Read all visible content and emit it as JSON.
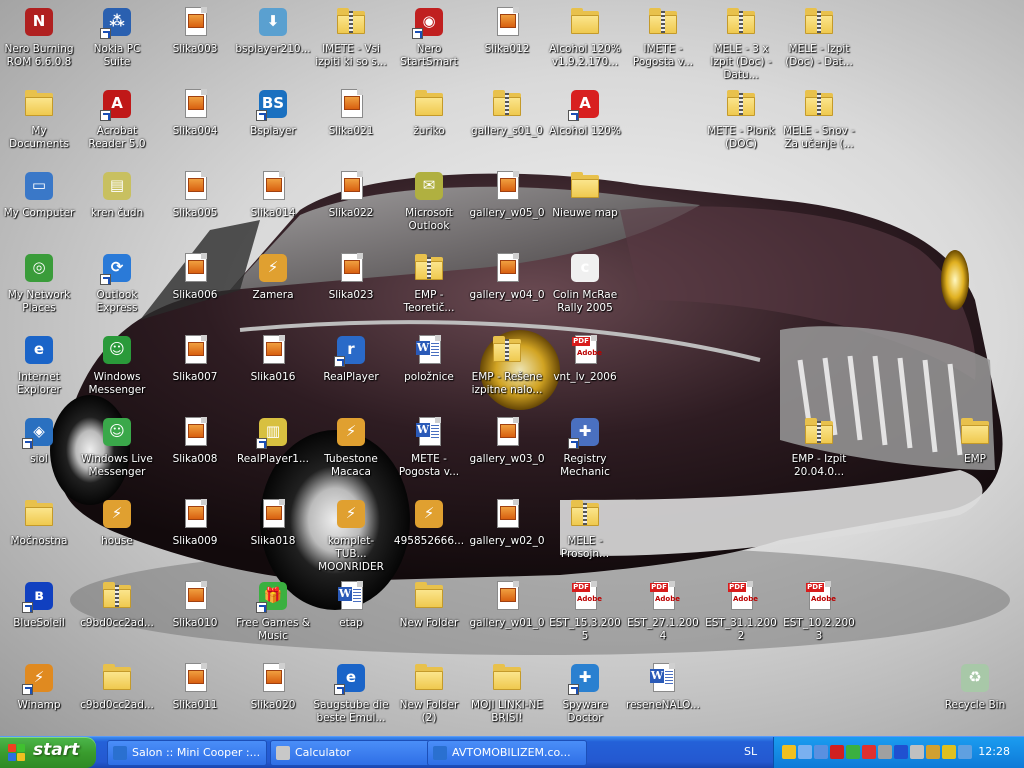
{
  "desktop": {
    "icons": [
      {
        "label": "Nero Burning ROM 6.6.0.8",
        "type": "app",
        "color": "#b02020",
        "sym": "N",
        "shortcut": false
      },
      {
        "label": "My Documents",
        "type": "folder",
        "shortcut": false
      },
      {
        "label": "My Computer",
        "type": "app",
        "color": "#3a78c8",
        "sym": "▭",
        "shortcut": false
      },
      {
        "label": "My Network Places",
        "type": "app",
        "color": "#3a9c3a",
        "sym": "◎",
        "shortcut": false
      },
      {
        "label": "Internet Explorer",
        "type": "app",
        "color": "#1a64c8",
        "sym": "e",
        "shortcut": false
      },
      {
        "label": "siol",
        "type": "app",
        "color": "#2a70c0",
        "sym": "◈",
        "shortcut": true
      },
      {
        "label": "Močnostna",
        "type": "folder",
        "shortcut": false
      },
      {
        "label": "BlueSoleil",
        "type": "app",
        "color": "#1040c0",
        "sym": "ʙ",
        "shortcut": true
      },
      {
        "label": "Winamp",
        "type": "app",
        "color": "#e08a20",
        "sym": "⚡",
        "shortcut": true
      },
      {
        "label": "Nokia PC Suite",
        "type": "app",
        "color": "#2a60b0",
        "sym": "⁂",
        "shortcut": true
      },
      {
        "label": "Acrobat Reader 5.0",
        "type": "app",
        "color": "#c01818",
        "sym": "A",
        "shortcut": true
      },
      {
        "label": "kren čudn",
        "type": "app",
        "color": "#c8c060",
        "sym": "▤",
        "shortcut": false
      },
      {
        "label": "Outlook Express",
        "type": "app",
        "color": "#2a7ad8",
        "sym": "⟳",
        "shortcut": true
      },
      {
        "label": "Windows Messenger",
        "type": "app",
        "color": "#2a9a3a",
        "sym": "☺",
        "shortcut": false
      },
      {
        "label": "Windows Live Messenger",
        "type": "app",
        "color": "#3aa84a",
        "sym": "☺",
        "shortcut": false
      },
      {
        "label": "house",
        "type": "app",
        "color": "#e0a030",
        "sym": "⚡",
        "shortcut": false
      },
      {
        "label": "c9bd0cc2ad...",
        "type": "zip",
        "shortcut": false
      },
      {
        "label": "c9bd0cc2ad...",
        "type": "folder",
        "shortcut": false
      },
      {
        "label": "Slika003",
        "type": "img",
        "shortcut": false
      },
      {
        "label": "Slika004",
        "type": "img",
        "shortcut": false
      },
      {
        "label": "Slika005",
        "type": "img",
        "shortcut": false
      },
      {
        "label": "Slika006",
        "type": "img",
        "shortcut": false
      },
      {
        "label": "Slika007",
        "type": "img",
        "shortcut": false
      },
      {
        "label": "Slika008",
        "type": "img",
        "shortcut": false
      },
      {
        "label": "Slika009",
        "type": "img",
        "shortcut": false
      },
      {
        "label": "Slika010",
        "type": "img",
        "shortcut": false
      },
      {
        "label": "Slika011",
        "type": "img",
        "shortcut": false
      },
      {
        "label": "bsplayer210...",
        "type": "app",
        "color": "#5aa0d0",
        "sym": "⬇",
        "shortcut": false
      },
      {
        "label": "Bsplayer",
        "type": "app",
        "color": "#1a70c0",
        "sym": "BS",
        "shortcut": true
      },
      {
        "label": "Slika014",
        "type": "img",
        "shortcut": false
      },
      {
        "label": "Zamera",
        "type": "app",
        "color": "#e0a030",
        "sym": "⚡",
        "shortcut": false
      },
      {
        "label": "Slika016",
        "type": "img",
        "shortcut": false
      },
      {
        "label": "RealPlayer1...",
        "type": "app",
        "color": "#d8c040",
        "sym": "▥",
        "shortcut": true
      },
      {
        "label": "Slika018",
        "type": "img",
        "shortcut": false
      },
      {
        "label": "Free Games & Music",
        "type": "app",
        "color": "#3ab040",
        "sym": "🎁",
        "shortcut": true
      },
      {
        "label": "Slika020",
        "type": "img",
        "shortcut": false
      },
      {
        "label": "IMETE - Vsi izpiti ki so s...",
        "type": "zip",
        "shortcut": false
      },
      {
        "label": "Slika021",
        "type": "img",
        "shortcut": false
      },
      {
        "label": "Slika022",
        "type": "img",
        "shortcut": false
      },
      {
        "label": "Slika023",
        "type": "img",
        "shortcut": false
      },
      {
        "label": "RealPlayer",
        "type": "app",
        "color": "#2a6ac8",
        "sym": "r",
        "shortcut": true
      },
      {
        "label": "Tubestone Macaca",
        "type": "app",
        "color": "#e0a030",
        "sym": "⚡",
        "shortcut": false
      },
      {
        "label": "komplet-TUB... MOONRIDER",
        "type": "app",
        "color": "#e0a030",
        "sym": "⚡",
        "shortcut": false
      },
      {
        "label": "etap",
        "type": "word",
        "shortcut": false
      },
      {
        "label": "Saugstube die beste Emul...",
        "type": "app",
        "color": "#1a64c8",
        "sym": "e",
        "shortcut": true
      },
      {
        "label": "Nero StartSmart",
        "type": "app",
        "color": "#c02020",
        "sym": "◉",
        "shortcut": true
      },
      {
        "label": "žuriko",
        "type": "folder",
        "shortcut": false
      },
      {
        "label": "Microsoft Outlook",
        "type": "app",
        "color": "#b0b040",
        "sym": "✉",
        "shortcut": false
      },
      {
        "label": "EMP - Teoretič...",
        "type": "zip",
        "shortcut": false
      },
      {
        "label": "položnice",
        "type": "word",
        "shortcut": false
      },
      {
        "label": "METE - Pogosta v...",
        "type": "word",
        "shortcut": false
      },
      {
        "label": "495852666...",
        "type": "app",
        "color": "#e0a030",
        "sym": "⚡",
        "shortcut": false
      },
      {
        "label": "New Folder",
        "type": "folder",
        "shortcut": false
      },
      {
        "label": "New Folder (2)",
        "type": "folder",
        "shortcut": false
      },
      {
        "label": "Slika012",
        "type": "img",
        "shortcut": false
      },
      {
        "label": "gallery_s01_0",
        "type": "zip",
        "shortcut": false
      },
      {
        "label": "gallery_w05_0",
        "type": "img",
        "shortcut": false
      },
      {
        "label": "gallery_w04_0",
        "type": "img",
        "shortcut": false
      },
      {
        "label": "EMP - Rešene izpitne nalo...",
        "type": "zip",
        "shortcut": false
      },
      {
        "label": "gallery_w03_0",
        "type": "img",
        "shortcut": false
      },
      {
        "label": "gallery_w02_0",
        "type": "img",
        "shortcut": false
      },
      {
        "label": "gallery_w01_0",
        "type": "img",
        "shortcut": false
      },
      {
        "label": "MOJI LINKI-NE BRISI!",
        "type": "folder",
        "shortcut": false
      },
      {
        "label": "Alcohol 120% v1.9.2.170...",
        "type": "folder",
        "shortcut": false
      },
      {
        "label": "Alcohol 120%",
        "type": "app",
        "color": "#d82020",
        "sym": "A",
        "shortcut": true
      },
      {
        "label": "Nieuwe map",
        "type": "folder",
        "shortcut": false
      },
      {
        "label": "Colin McRae Rally 2005",
        "type": "app",
        "color": "#f0f0f0",
        "sym": "c",
        "shortcut": false
      },
      {
        "label": "vnt_lv_2006",
        "type": "pdf",
        "shortcut": false
      },
      {
        "label": "Registry Mechanic",
        "type": "app",
        "color": "#4a70c0",
        "sym": "✚",
        "shortcut": true
      },
      {
        "label": "MELE - Prosojn...",
        "type": "zip",
        "shortcut": false
      },
      {
        "label": "EST_15.3.2005",
        "type": "pdf",
        "shortcut": false
      },
      {
        "label": "Spyware Doctor",
        "type": "app",
        "color": "#2a80d0",
        "sym": "✚",
        "shortcut": true
      },
      {
        "label": "IMETE - Pogosta v...",
        "type": "zip",
        "shortcut": false
      },
      {
        "label": "EST_27.1.2004",
        "type": "pdf",
        "shortcut": false
      },
      {
        "label": "reseneNALO...",
        "type": "word",
        "shortcut": false
      },
      {
        "label": "MELE - 3 x Izpit (Doc) - Datu...",
        "type": "zip",
        "shortcut": false
      },
      {
        "label": "METE - Plonk (DOC)",
        "type": "zip",
        "shortcut": false
      },
      {
        "label": "EST_31.1.2002",
        "type": "pdf",
        "shortcut": false
      },
      {
        "label": "MELE - Izpit (Doc) - Dat...",
        "type": "zip",
        "shortcut": false
      },
      {
        "label": "MELE - Snov - Za učenje (...",
        "type": "zip",
        "shortcut": false
      },
      {
        "label": "EMP - Izpit 20.04.0...",
        "type": "zip",
        "shortcut": false
      },
      {
        "label": "EST_10.2.2003",
        "type": "pdf",
        "shortcut": false
      },
      {
        "label": "EMP",
        "type": "folder",
        "shortcut": false
      },
      {
        "label": "Recycle Bin",
        "type": "app",
        "color": "#a8c8a8",
        "sym": "♻",
        "shortcut": false
      }
    ]
  },
  "taskbar": {
    "start_label": "start",
    "tasks": [
      {
        "label": "Salon :: Mini Cooper :...",
        "color": "#2a70d0"
      },
      {
        "label": "Calculator",
        "color": "#c8c8c8"
      },
      {
        "label": "AVTOMOBILIZEM.co...",
        "color": "#2a70d0"
      }
    ],
    "language": "SL",
    "tray_icons": [
      {
        "name": "shield-icon",
        "color": "#f0c020"
      },
      {
        "name": "network-icon",
        "color": "#7ab0f0"
      },
      {
        "name": "monitor-icon",
        "color": "#5a90e0"
      },
      {
        "name": "nero-icon",
        "color": "#d02020"
      },
      {
        "name": "messenger-icon",
        "color": "#3ab040"
      },
      {
        "name": "antivirus-icon",
        "color": "#e03030"
      },
      {
        "name": "wrench-icon",
        "color": "#a0a0a0"
      },
      {
        "name": "bluetooth-icon",
        "color": "#2050d0"
      },
      {
        "name": "speaker-icon",
        "color": "#c0c0c0"
      },
      {
        "name": "sync-icon",
        "color": "#d0a030"
      },
      {
        "name": "power-icon",
        "color": "#e0c020"
      },
      {
        "name": "user-icon",
        "color": "#60a0e0"
      }
    ],
    "clock": "12:28"
  }
}
